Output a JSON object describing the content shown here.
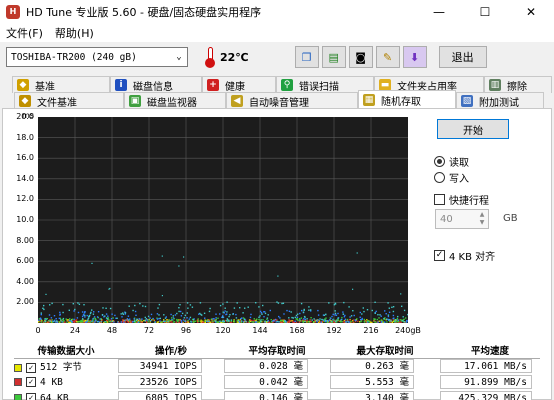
{
  "window": {
    "title": "HD Tune 专业版 5.60 - 硬盘/固态硬盘实用程序",
    "minimize": "—",
    "maximize": "☐",
    "close": "✕"
  },
  "menu": [
    "文件(F)",
    "帮助(H)"
  ],
  "toolbar": {
    "drive": "TOSHIBA-TR200 (240 gB)",
    "temperature": "22℃",
    "exit_label": "退出"
  },
  "tabs_row1": [
    "基准",
    "磁盘信息",
    "健康",
    "错误扫描",
    "文件夹占用率",
    "擦除"
  ],
  "tabs_row2": [
    "文件基准",
    "磁盘监视器",
    "自动噪音管理",
    "随机存取",
    "附加测试"
  ],
  "active_tab": "随机存取",
  "chart_data": {
    "type": "scatter",
    "ylabel": "ms",
    "y_ticks": [
      "20.0",
      "18.0",
      "16.0",
      "14.0",
      "12.0",
      "10.0",
      "8.00",
      "6.00",
      "4.00",
      "2.00"
    ],
    "x_ticks": [
      "0",
      "24",
      "48",
      "72",
      "96",
      "120",
      "144",
      "168",
      "192",
      "216",
      "240gB"
    ],
    "xlim": [
      0,
      240
    ],
    "ylim": [
      0,
      20
    ],
    "series": [
      {
        "color": "#e8e800",
        "y_band": [
          0.02,
          0.3
        ]
      },
      {
        "color": "#d03030",
        "y_band": [
          0.02,
          0.3
        ]
      },
      {
        "color": "#3cc83c",
        "y_band": [
          0.05,
          0.5
        ]
      },
      {
        "color": "#2e80ff",
        "y_band": [
          0.05,
          1.2
        ]
      },
      {
        "color": "#40c8c8",
        "y_band": [
          0.1,
          2.0
        ]
      }
    ],
    "grid": true
  },
  "controls": {
    "start": "开始",
    "read": "读取",
    "write": "写入",
    "quick_scan": "快捷行程",
    "scan_size": "40",
    "unit": "GB",
    "align_4kb": "4 KB 对齐"
  },
  "results": {
    "headers": [
      "传输数据大小",
      "操作/秒",
      "平均存取时间",
      "最大存取时间",
      "平均速度"
    ],
    "rows": [
      {
        "color": "#e8e800",
        "size": "512 字节",
        "ops": "34941 IOPS",
        "avg": "0.028 毫",
        "max": "0.263 毫",
        "speed": "17.061 MB/s"
      },
      {
        "color": "#d03030",
        "size": "4 KB",
        "ops": "23526 IOPS",
        "avg": "0.042 毫",
        "max": "5.553 毫",
        "speed": "91.899 MB/s"
      },
      {
        "color": "#3cc83c",
        "size": "64 KB",
        "ops": "6805 IOPS",
        "avg": "0.146 毫",
        "max": "3.140 毫",
        "speed": "425.329 MB/s"
      }
    ]
  }
}
